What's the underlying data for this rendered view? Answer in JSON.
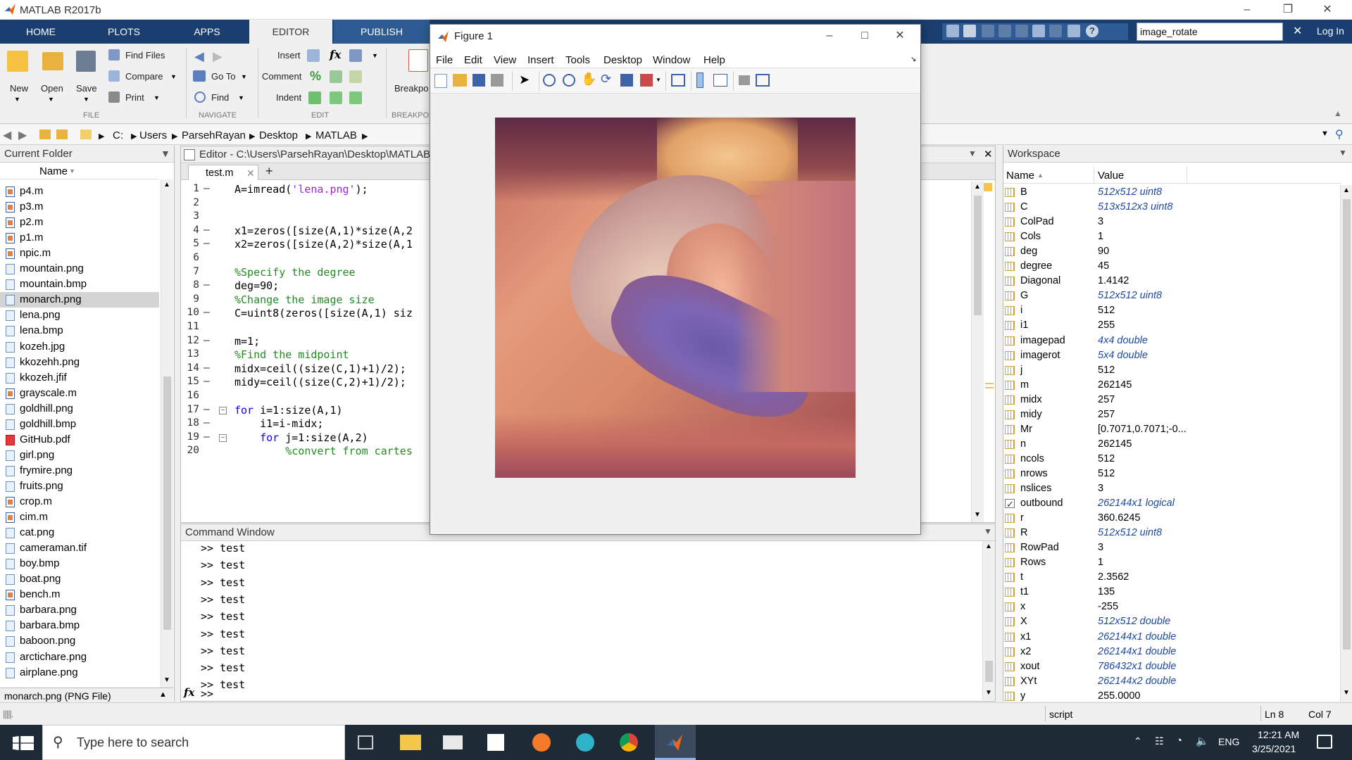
{
  "app": {
    "title": "MATLAB R2017b"
  },
  "tabs": [
    "HOME",
    "PLOTS",
    "APPS",
    "EDITOR",
    "PUBLISH"
  ],
  "quick_search": {
    "value": "image_rotate",
    "login": "Log In"
  },
  "ribbon": {
    "file": {
      "new": "New",
      "open": "Open",
      "save": "Save",
      "find_files": "Find Files",
      "compare": "Compare",
      "print": "Print",
      "label": "FILE"
    },
    "navigate": {
      "go_to": "Go To",
      "find": "Find",
      "label": "NAVIGATE"
    },
    "edit": {
      "insert": "Insert",
      "comment": "Comment",
      "indent": "Indent",
      "label": "EDIT",
      "fx": "fx"
    },
    "breakpoints": {
      "label": "Breakpo",
      "group": "BREAKPOI"
    }
  },
  "address": {
    "path": [
      "C:",
      "Users",
      "ParsehRayan",
      "Desktop",
      "MATLAB"
    ]
  },
  "current_folder": {
    "title": "Current Folder",
    "column": "Name",
    "files": [
      {
        "name": "p4.m",
        "type": "m"
      },
      {
        "name": "p3.m",
        "type": "m"
      },
      {
        "name": "p2.m",
        "type": "m"
      },
      {
        "name": "p1.m",
        "type": "m"
      },
      {
        "name": "npic.m",
        "type": "m"
      },
      {
        "name": "mountain.png",
        "type": "img"
      },
      {
        "name": "mountain.bmp",
        "type": "img"
      },
      {
        "name": "monarch.png",
        "type": "img"
      },
      {
        "name": "lena.png",
        "type": "img"
      },
      {
        "name": "lena.bmp",
        "type": "img"
      },
      {
        "name": "kozeh.jpg",
        "type": "img"
      },
      {
        "name": "kkozehh.png",
        "type": "img"
      },
      {
        "name": "kkozeh.jfif",
        "type": "img"
      },
      {
        "name": "grayscale.m",
        "type": "m"
      },
      {
        "name": "goldhill.png",
        "type": "img"
      },
      {
        "name": "goldhill.bmp",
        "type": "img"
      },
      {
        "name": "GitHub.pdf",
        "type": "pdf"
      },
      {
        "name": "girl.png",
        "type": "img"
      },
      {
        "name": "frymire.png",
        "type": "img"
      },
      {
        "name": "fruits.png",
        "type": "img"
      },
      {
        "name": "crop.m",
        "type": "m"
      },
      {
        "name": "cim.m",
        "type": "m"
      },
      {
        "name": "cat.png",
        "type": "img"
      },
      {
        "name": "cameraman.tif",
        "type": "img"
      },
      {
        "name": "boy.bmp",
        "type": "img"
      },
      {
        "name": "boat.png",
        "type": "img"
      },
      {
        "name": "bench.m",
        "type": "m"
      },
      {
        "name": "barbara.png",
        "type": "img"
      },
      {
        "name": "barbara.bmp",
        "type": "img"
      },
      {
        "name": "baboon.png",
        "type": "img"
      },
      {
        "name": "arcticharе.png",
        "type": "img"
      },
      {
        "name": "airplane.png",
        "type": "img"
      }
    ],
    "selected": "monarch.png",
    "details": "monarch.png  (PNG File)"
  },
  "editor": {
    "title": "Editor - C:\\Users\\ParsehRayan\\Desktop\\MATLAB\\",
    "tab": "test.m",
    "lines": [
      {
        "n": "1",
        "d": "–",
        "code": "A=imread('lena.png');"
      },
      {
        "n": "2",
        "d": "",
        "code": ""
      },
      {
        "n": "3",
        "d": "",
        "code": ""
      },
      {
        "n": "4",
        "d": "–",
        "code": "x1=zeros([size(A,1)*size(A,2"
      },
      {
        "n": "5",
        "d": "–",
        "code": "x2=zeros([size(A,2)*size(A,1"
      },
      {
        "n": "6",
        "d": "",
        "code": ""
      },
      {
        "n": "7",
        "d": "",
        "code": "%Specify the degree"
      },
      {
        "n": "8",
        "d": "–",
        "code": "deg=90;"
      },
      {
        "n": "9",
        "d": "",
        "code": "%Change the image size"
      },
      {
        "n": "10",
        "d": "–",
        "code": "C=uint8(zeros([size(A,1) siz"
      },
      {
        "n": "11",
        "d": "",
        "code": ""
      },
      {
        "n": "12",
        "d": "–",
        "code": "m=1;"
      },
      {
        "n": "13",
        "d": "",
        "code": "%Find the midpoint"
      },
      {
        "n": "14",
        "d": "–",
        "code": "midx=ceil((size(C,1)+1)/2);"
      },
      {
        "n": "15",
        "d": "–",
        "code": "midy=ceil((size(C,2)+1)/2);"
      },
      {
        "n": "16",
        "d": "",
        "code": ""
      },
      {
        "n": "17",
        "d": "–",
        "code": "for i=1:size(A,1)"
      },
      {
        "n": "18",
        "d": "–",
        "code": "    i1=i-midx;"
      },
      {
        "n": "19",
        "d": "–",
        "code": "    for j=1:size(A,2)"
      },
      {
        "n": "20",
        "d": "",
        "code": "        %convert from cartes"
      }
    ]
  },
  "command_window": {
    "title": "Command Window",
    "history": [
      ">> test",
      ">> test",
      ">> test",
      ">> test",
      ">> test",
      ">> test",
      ">> test",
      ">> test",
      ">> test"
    ],
    "prompt": ">>",
    "fx": "fx"
  },
  "workspace": {
    "title": "Workspace",
    "columns": [
      "Name",
      "Value"
    ],
    "vars": [
      {
        "name": "B",
        "value": "512x512 uint8",
        "italic": true
      },
      {
        "name": "C",
        "value": "513x512x3 uint8",
        "italic": true
      },
      {
        "name": "ColPad",
        "value": "3",
        "italic": false
      },
      {
        "name": "Cols",
        "value": "1",
        "italic": false
      },
      {
        "name": "deg",
        "value": "90",
        "italic": false
      },
      {
        "name": "degree",
        "value": "45",
        "italic": false
      },
      {
        "name": "Diagonal",
        "value": "1.4142",
        "italic": false
      },
      {
        "name": "G",
        "value": "512x512 uint8",
        "italic": true
      },
      {
        "name": "i",
        "value": "512",
        "italic": false
      },
      {
        "name": "i1",
        "value": "255",
        "italic": false
      },
      {
        "name": "imagepad",
        "value": "4x4 double",
        "italic": true
      },
      {
        "name": "imagerot",
        "value": "5x4 double",
        "italic": true
      },
      {
        "name": "j",
        "value": "512",
        "italic": false
      },
      {
        "name": "m",
        "value": "262145",
        "italic": false
      },
      {
        "name": "midx",
        "value": "257",
        "italic": false
      },
      {
        "name": "midy",
        "value": "257",
        "italic": false
      },
      {
        "name": "Mr",
        "value": "[0.7071,0.7071;-0...",
        "italic": false
      },
      {
        "name": "n",
        "value": "262145",
        "italic": false
      },
      {
        "name": "ncols",
        "value": "512",
        "italic": false
      },
      {
        "name": "nrows",
        "value": "512",
        "italic": false
      },
      {
        "name": "nslices",
        "value": "3",
        "italic": false
      },
      {
        "name": "outbound",
        "value": "262144x1 logical",
        "italic": true
      },
      {
        "name": "r",
        "value": "360.6245",
        "italic": false
      },
      {
        "name": "R",
        "value": "512x512 uint8",
        "italic": true
      },
      {
        "name": "RowPad",
        "value": "3",
        "italic": false
      },
      {
        "name": "Rows",
        "value": "1",
        "italic": false
      },
      {
        "name": "t",
        "value": "2.3562",
        "italic": false
      },
      {
        "name": "t1",
        "value": "135",
        "italic": false
      },
      {
        "name": "x",
        "value": "-255",
        "italic": false
      },
      {
        "name": "X",
        "value": "512x512 double",
        "italic": true
      },
      {
        "name": "x1",
        "value": "262144x1 double",
        "italic": true
      },
      {
        "name": "x2",
        "value": "262144x1 double",
        "italic": true
      },
      {
        "name": "xout",
        "value": "786432x1 double",
        "italic": true
      },
      {
        "name": "XYt",
        "value": "262144x2 double",
        "italic": true
      },
      {
        "name": "y",
        "value": "255.0000",
        "italic": false
      }
    ]
  },
  "statusbar": {
    "script": "script",
    "ln": "Ln  8",
    "col": "Col  7"
  },
  "figure": {
    "title": "Figure 1",
    "menu": [
      "File",
      "Edit",
      "View",
      "Insert",
      "Tools",
      "Desktop",
      "Window",
      "Help"
    ]
  },
  "taskbar": {
    "search_placeholder": "Type here to search",
    "lang": "ENG",
    "time": "12:21 AM",
    "date": "3/25/2021"
  }
}
